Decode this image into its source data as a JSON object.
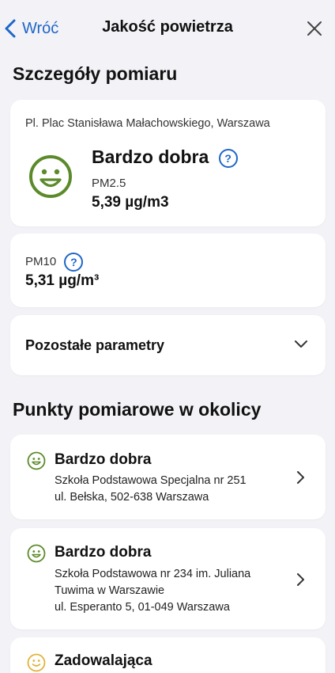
{
  "nav": {
    "back_label": "Wróć",
    "title": "Jakość powietrza"
  },
  "details": {
    "section_title": "Szczegóły pomiaru",
    "address": "Pl. Plac Stanisława Małachowskiego, Warszawa",
    "quality": "Bardzo dobra",
    "pm25_label": "PM2.5",
    "pm25_value": "5,39 µg/m3",
    "pm10_label": "PM10",
    "pm10_value": "5,31 µg/m³",
    "other_params_label": "Pozostałe parametry"
  },
  "nearby": {
    "section_title": "Punkty pomiarowe w okolicy",
    "points": [
      {
        "quality": "Bardzo dobra",
        "lines": [
          "Szkoła Podstawowa Specjalna nr 251",
          "ul. Bełska, 502-638 Warszawa"
        ]
      },
      {
        "quality": "Bardzo dobra",
        "lines": [
          "Szkoła Podstawowa nr 234 im. Juliana",
          "Tuwima w Warszawie",
          "ul. Esperanto 5, 01-049 Warszawa"
        ]
      },
      {
        "quality": "Zadowalająca",
        "lines": []
      }
    ]
  },
  "icons": {
    "help": "?",
    "very_good_face": "smiley-icon",
    "satisfactory_face": "smiley-icon"
  },
  "colors": {
    "accent": "#1f66c7",
    "very_good": "#5c8a2a",
    "satisfactory": "#e0b43a",
    "background": "#f2f2f7"
  }
}
